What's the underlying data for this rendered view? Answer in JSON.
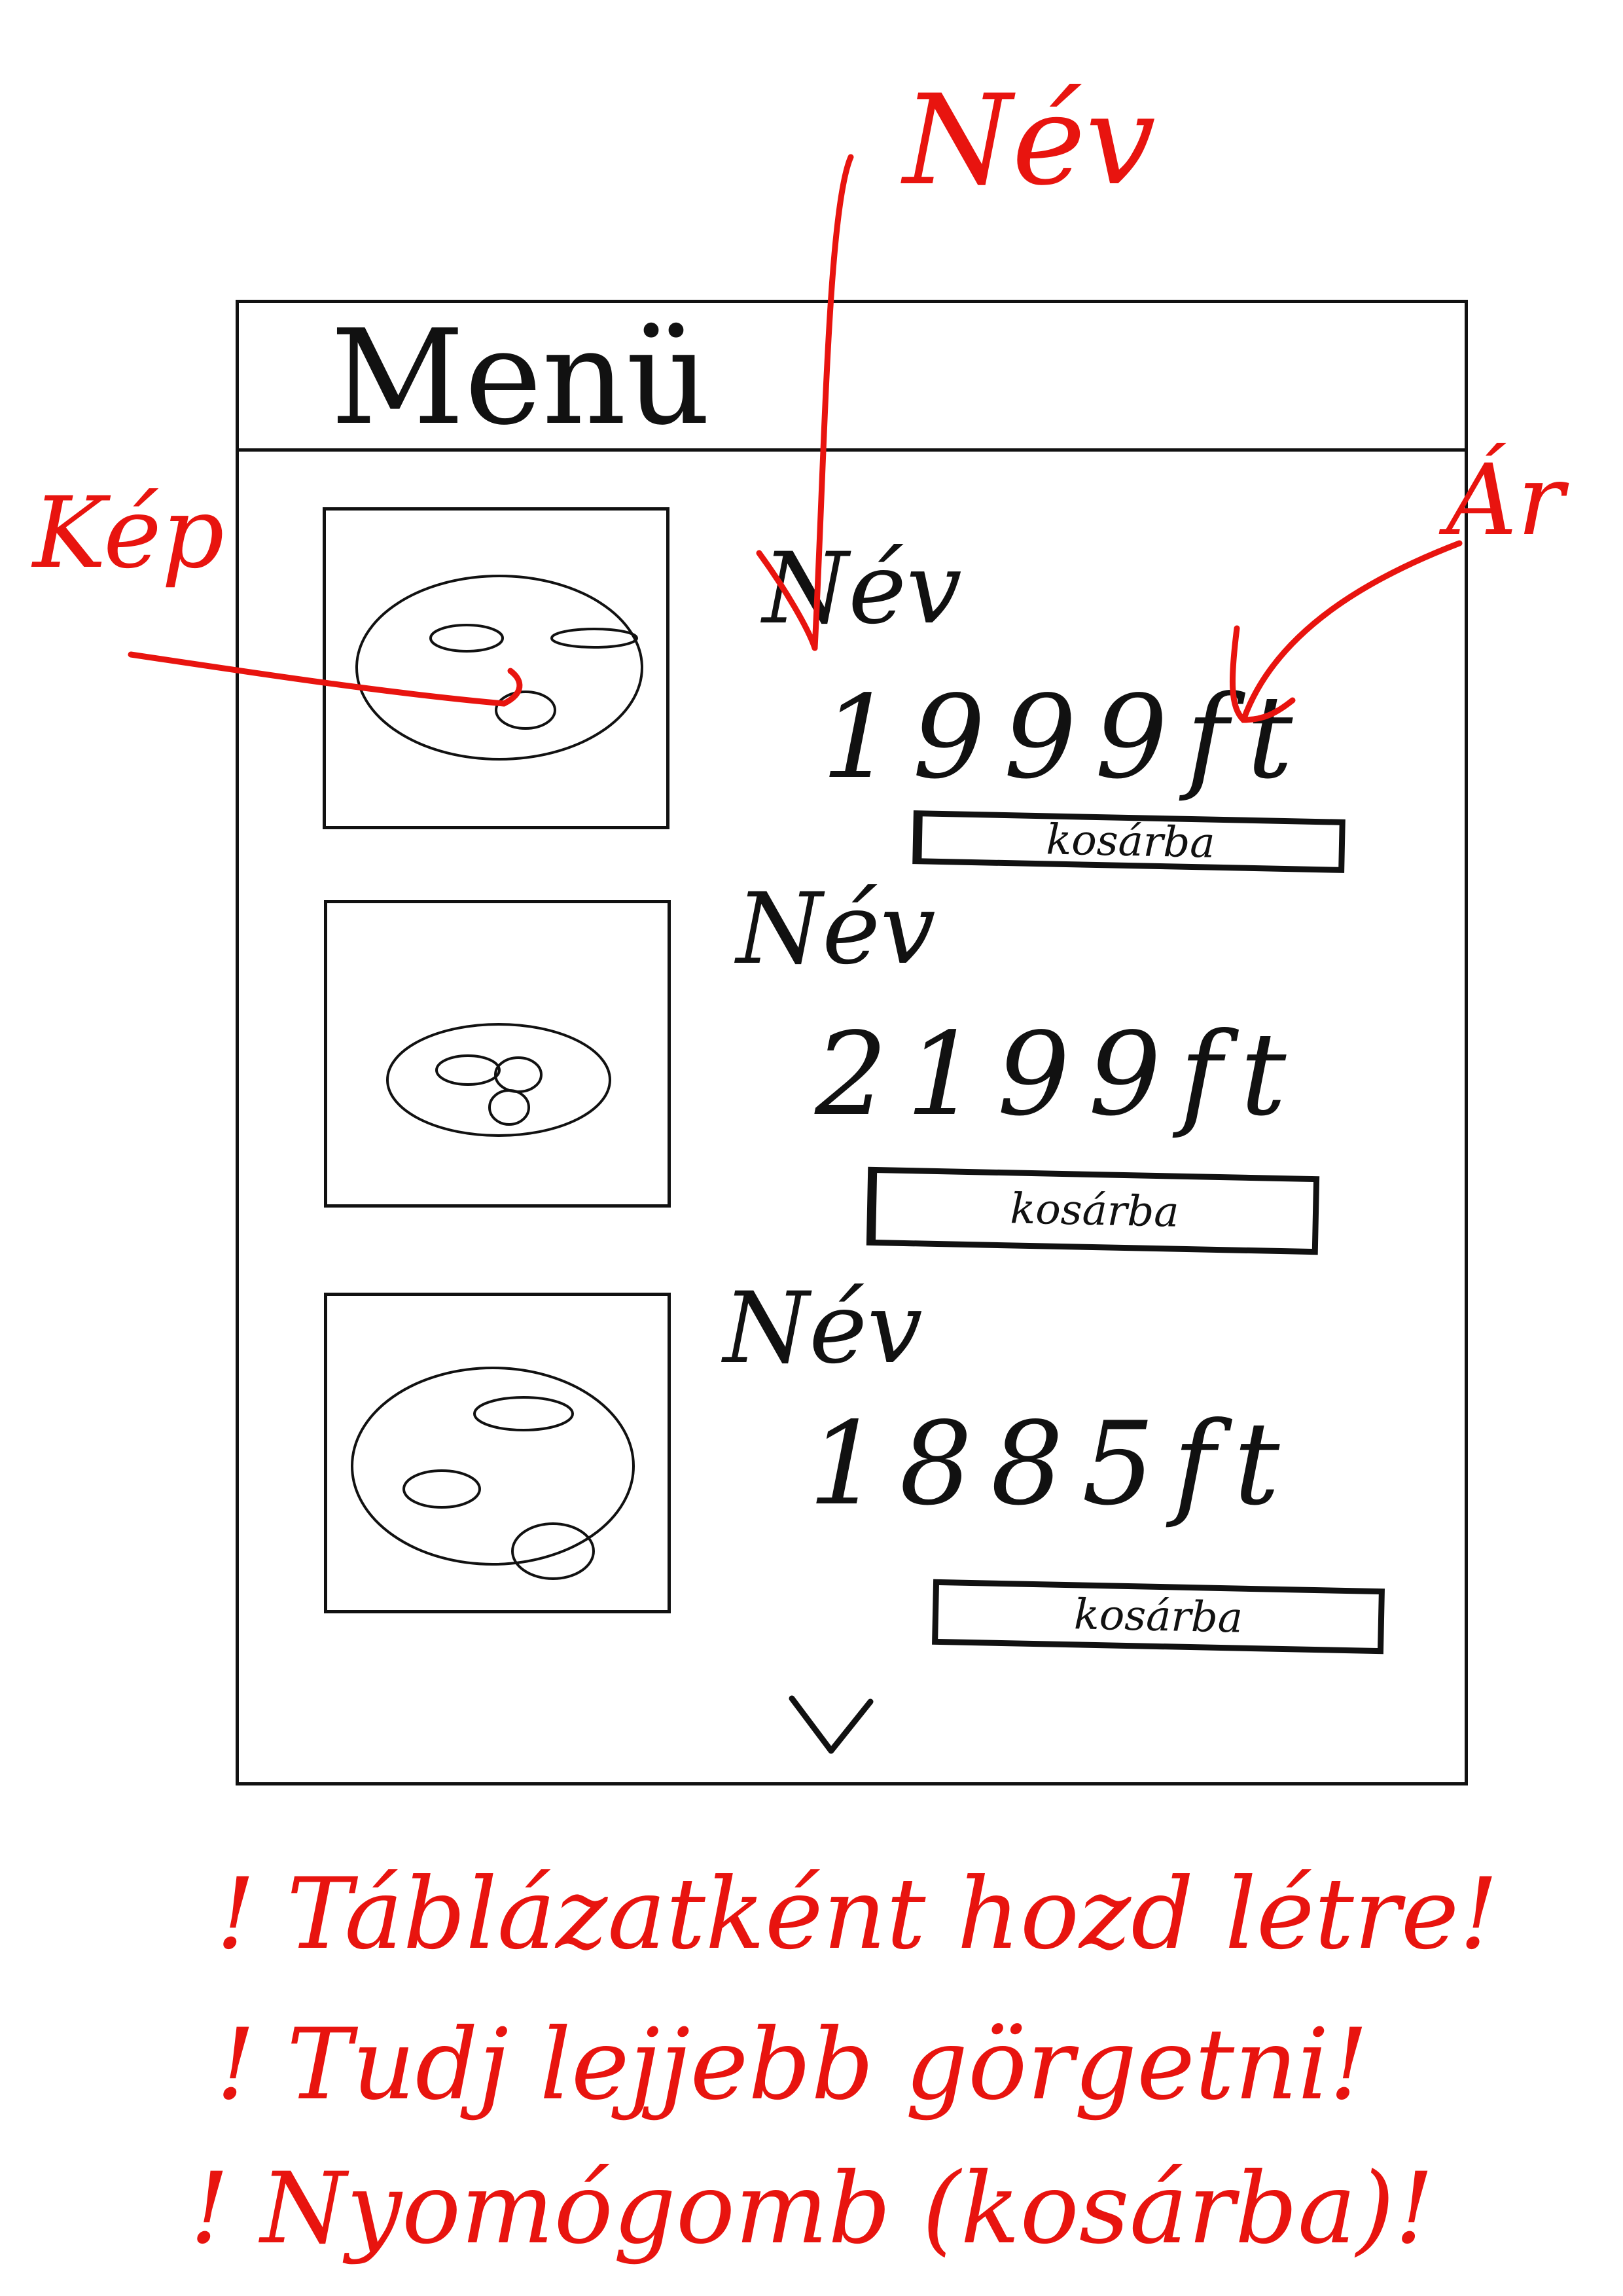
{
  "header": {
    "title": "Menü"
  },
  "menu_items": [
    {
      "name": "Név",
      "price": "1999ft",
      "button_label": "kosárba"
    },
    {
      "name": "Név",
      "price": "2199ft",
      "button_label": "kosárba"
    },
    {
      "name": "Név",
      "price": "1885ft",
      "button_label": "kosárba"
    }
  ],
  "annotations": {
    "image_label": "Kép",
    "name_label": "Név",
    "price_label": "Ár",
    "notes": [
      "! Táblázatként hozd létre!",
      "! Tudj lejjebb görgetni!",
      "! Nyomógomb (kosárba)!"
    ]
  },
  "colors": {
    "ink": "#111111",
    "annotation": "#e8140f",
    "background": "#ffffff"
  },
  "icons": {
    "scroll_down": "chevron-down-icon"
  }
}
